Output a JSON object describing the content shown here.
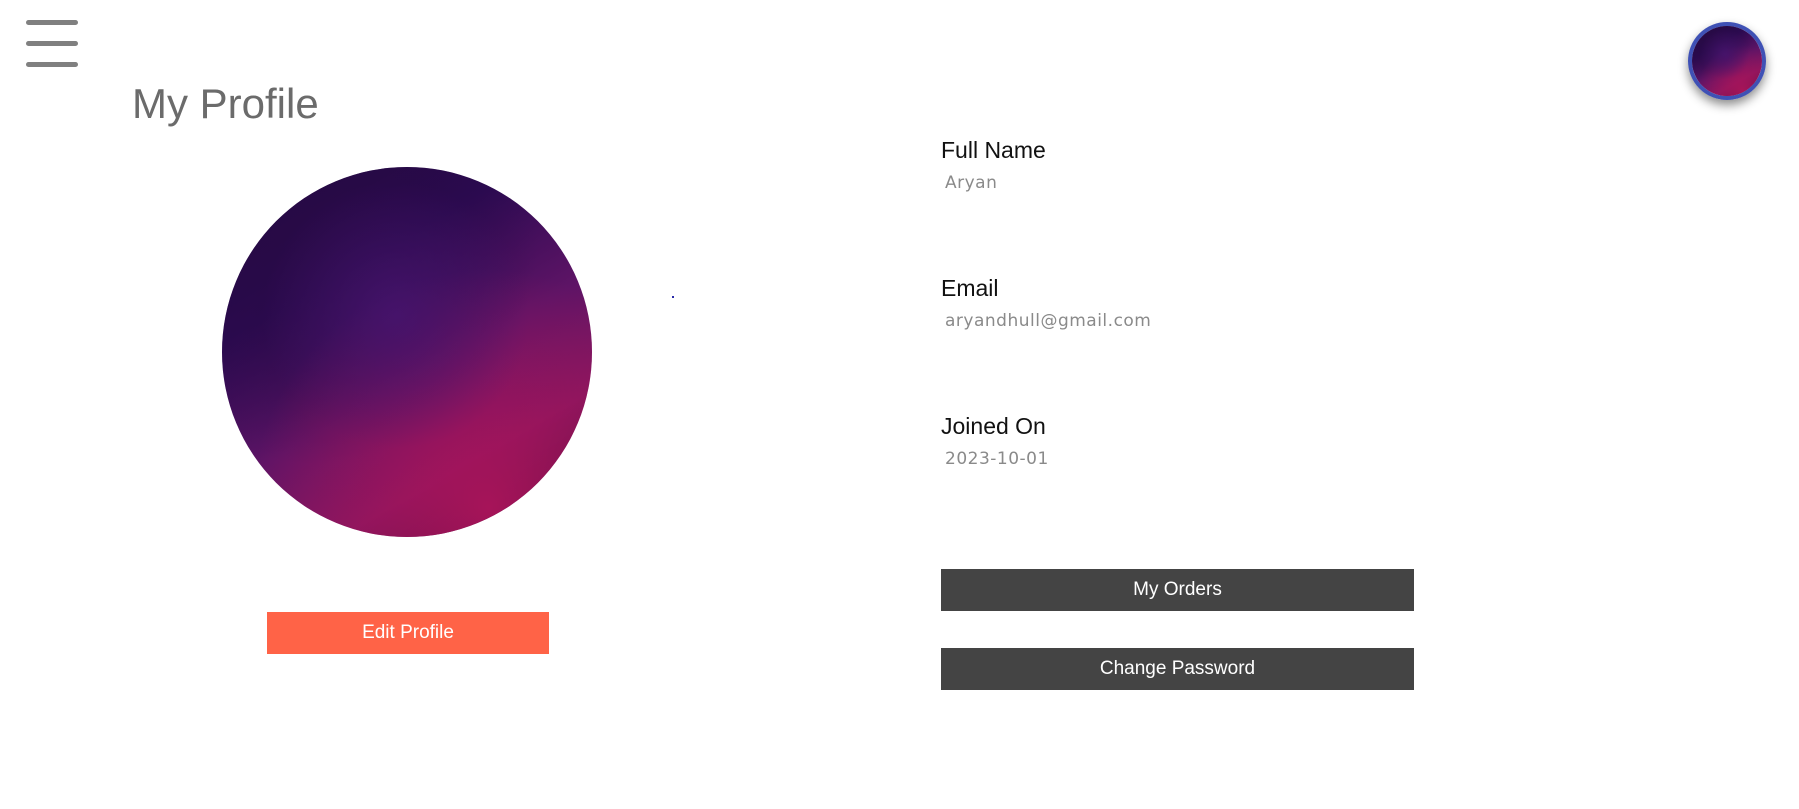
{
  "header": {
    "menu_icon": "hamburger-menu-icon",
    "avatar_colors": [
      "#1e0738",
      "#5e1466",
      "#821660"
    ],
    "avatar_border_color": "#3f51b5"
  },
  "profile": {
    "page_title": "My Profile",
    "edit_button_label": "Edit Profile",
    "edit_button_color": "#ff6347"
  },
  "details": {
    "fields": [
      {
        "label": "Full Name",
        "value": "Aryan"
      },
      {
        "label": "Email",
        "value": "aryandhull@gmail.com"
      },
      {
        "label": "Joined On",
        "value": "2023-10-01"
      }
    ]
  },
  "actions": {
    "orders_label": "My Orders",
    "change_password_label": "Change Password",
    "button_color": "#444444"
  }
}
